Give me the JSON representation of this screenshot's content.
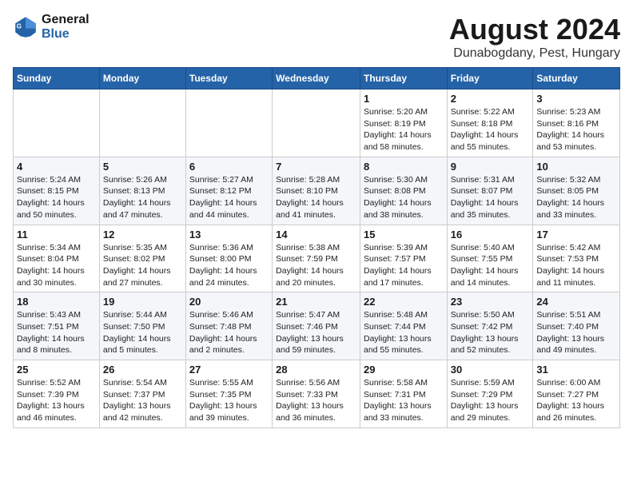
{
  "header": {
    "logo_line1": "General",
    "logo_line2": "Blue",
    "title": "August 2024",
    "subtitle": "Dunabogdany, Pest, Hungary"
  },
  "weekdays": [
    "Sunday",
    "Monday",
    "Tuesday",
    "Wednesday",
    "Thursday",
    "Friday",
    "Saturday"
  ],
  "weeks": [
    [
      {
        "day": "",
        "info": ""
      },
      {
        "day": "",
        "info": ""
      },
      {
        "day": "",
        "info": ""
      },
      {
        "day": "",
        "info": ""
      },
      {
        "day": "1",
        "info": "Sunrise: 5:20 AM\nSunset: 8:19 PM\nDaylight: 14 hours\nand 58 minutes."
      },
      {
        "day": "2",
        "info": "Sunrise: 5:22 AM\nSunset: 8:18 PM\nDaylight: 14 hours\nand 55 minutes."
      },
      {
        "day": "3",
        "info": "Sunrise: 5:23 AM\nSunset: 8:16 PM\nDaylight: 14 hours\nand 53 minutes."
      }
    ],
    [
      {
        "day": "4",
        "info": "Sunrise: 5:24 AM\nSunset: 8:15 PM\nDaylight: 14 hours\nand 50 minutes."
      },
      {
        "day": "5",
        "info": "Sunrise: 5:26 AM\nSunset: 8:13 PM\nDaylight: 14 hours\nand 47 minutes."
      },
      {
        "day": "6",
        "info": "Sunrise: 5:27 AM\nSunset: 8:12 PM\nDaylight: 14 hours\nand 44 minutes."
      },
      {
        "day": "7",
        "info": "Sunrise: 5:28 AM\nSunset: 8:10 PM\nDaylight: 14 hours\nand 41 minutes."
      },
      {
        "day": "8",
        "info": "Sunrise: 5:30 AM\nSunset: 8:08 PM\nDaylight: 14 hours\nand 38 minutes."
      },
      {
        "day": "9",
        "info": "Sunrise: 5:31 AM\nSunset: 8:07 PM\nDaylight: 14 hours\nand 35 minutes."
      },
      {
        "day": "10",
        "info": "Sunrise: 5:32 AM\nSunset: 8:05 PM\nDaylight: 14 hours\nand 33 minutes."
      }
    ],
    [
      {
        "day": "11",
        "info": "Sunrise: 5:34 AM\nSunset: 8:04 PM\nDaylight: 14 hours\nand 30 minutes."
      },
      {
        "day": "12",
        "info": "Sunrise: 5:35 AM\nSunset: 8:02 PM\nDaylight: 14 hours\nand 27 minutes."
      },
      {
        "day": "13",
        "info": "Sunrise: 5:36 AM\nSunset: 8:00 PM\nDaylight: 14 hours\nand 24 minutes."
      },
      {
        "day": "14",
        "info": "Sunrise: 5:38 AM\nSunset: 7:59 PM\nDaylight: 14 hours\nand 20 minutes."
      },
      {
        "day": "15",
        "info": "Sunrise: 5:39 AM\nSunset: 7:57 PM\nDaylight: 14 hours\nand 17 minutes."
      },
      {
        "day": "16",
        "info": "Sunrise: 5:40 AM\nSunset: 7:55 PM\nDaylight: 14 hours\nand 14 minutes."
      },
      {
        "day": "17",
        "info": "Sunrise: 5:42 AM\nSunset: 7:53 PM\nDaylight: 14 hours\nand 11 minutes."
      }
    ],
    [
      {
        "day": "18",
        "info": "Sunrise: 5:43 AM\nSunset: 7:51 PM\nDaylight: 14 hours\nand 8 minutes."
      },
      {
        "day": "19",
        "info": "Sunrise: 5:44 AM\nSunset: 7:50 PM\nDaylight: 14 hours\nand 5 minutes."
      },
      {
        "day": "20",
        "info": "Sunrise: 5:46 AM\nSunset: 7:48 PM\nDaylight: 14 hours\nand 2 minutes."
      },
      {
        "day": "21",
        "info": "Sunrise: 5:47 AM\nSunset: 7:46 PM\nDaylight: 13 hours\nand 59 minutes."
      },
      {
        "day": "22",
        "info": "Sunrise: 5:48 AM\nSunset: 7:44 PM\nDaylight: 13 hours\nand 55 minutes."
      },
      {
        "day": "23",
        "info": "Sunrise: 5:50 AM\nSunset: 7:42 PM\nDaylight: 13 hours\nand 52 minutes."
      },
      {
        "day": "24",
        "info": "Sunrise: 5:51 AM\nSunset: 7:40 PM\nDaylight: 13 hours\nand 49 minutes."
      }
    ],
    [
      {
        "day": "25",
        "info": "Sunrise: 5:52 AM\nSunset: 7:39 PM\nDaylight: 13 hours\nand 46 minutes."
      },
      {
        "day": "26",
        "info": "Sunrise: 5:54 AM\nSunset: 7:37 PM\nDaylight: 13 hours\nand 42 minutes."
      },
      {
        "day": "27",
        "info": "Sunrise: 5:55 AM\nSunset: 7:35 PM\nDaylight: 13 hours\nand 39 minutes."
      },
      {
        "day": "28",
        "info": "Sunrise: 5:56 AM\nSunset: 7:33 PM\nDaylight: 13 hours\nand 36 minutes."
      },
      {
        "day": "29",
        "info": "Sunrise: 5:58 AM\nSunset: 7:31 PM\nDaylight: 13 hours\nand 33 minutes."
      },
      {
        "day": "30",
        "info": "Sunrise: 5:59 AM\nSunset: 7:29 PM\nDaylight: 13 hours\nand 29 minutes."
      },
      {
        "day": "31",
        "info": "Sunrise: 6:00 AM\nSunset: 7:27 PM\nDaylight: 13 hours\nand 26 minutes."
      }
    ]
  ]
}
